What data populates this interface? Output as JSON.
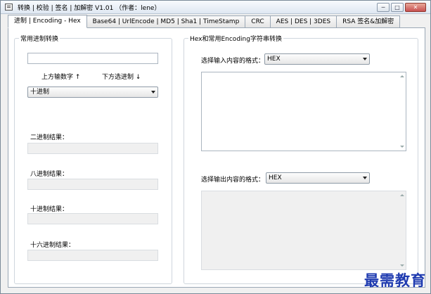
{
  "window": {
    "title": "转换 | 校验 | 签名 | 加解密 V1.01 （作者：lene）",
    "min": "─",
    "max": "□",
    "close": "✕"
  },
  "tabs": [
    {
      "label": "进制 | Encoding - Hex",
      "active": true
    },
    {
      "label": "Base64 | UrlEncode | MD5 | Sha1 | TimeStamp"
    },
    {
      "label": "CRC"
    },
    {
      "label": "AES | DES | 3DES"
    },
    {
      "label": "RSA 签名&加解密"
    }
  ],
  "left": {
    "group_title": "常用进制转换",
    "input_value": "",
    "hint_up": "上方输数字 ↑",
    "hint_down": "下方选进制 ↓",
    "base_select": "十进制",
    "bin_label": "二进制结果：",
    "oct_label": "八进制结果：",
    "dec_label": "十进制结果：",
    "hex_label": "十六进制结果：",
    "bin_value": "",
    "oct_value": "",
    "dec_value": "",
    "hex_value": ""
  },
  "right": {
    "group_title": "Hex和常用Encoding字符串转换",
    "input_format_label": "选择输入内容的格式：",
    "input_format": "HEX",
    "input_text": "",
    "output_format_label": "选择输出内容的格式：",
    "output_format": "HEX",
    "output_text": ""
  },
  "watermark": "最需教育"
}
